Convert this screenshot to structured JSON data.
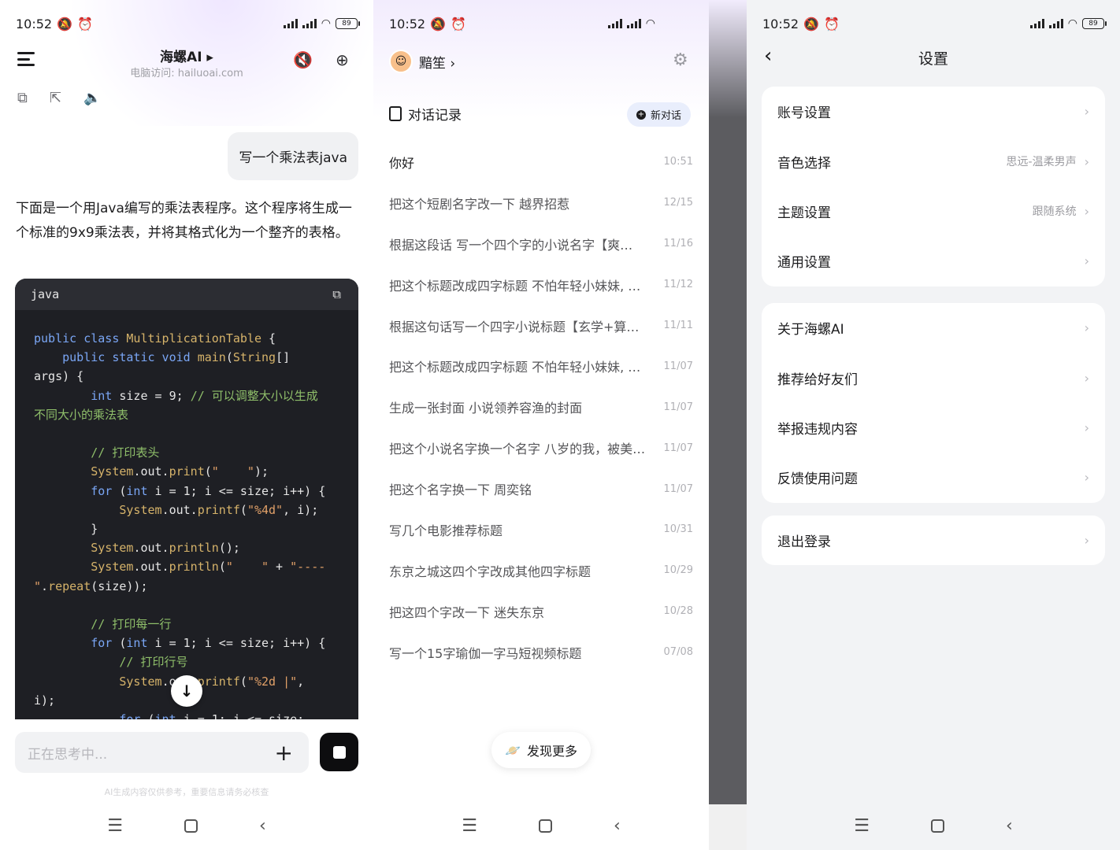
{
  "status": {
    "time": "10:52",
    "battery": "89"
  },
  "chat": {
    "title": "海螺AI ▸",
    "subtitle": "电脑访问: hailuoai.com",
    "user_message": "写一个乘法表java",
    "answer": "下面是一个用Java编写的乘法表程序。这个程序将生成一个标准的9x9乘法表，并将其格式化为一个整齐的表格。",
    "code_lang": "java",
    "input_placeholder": "正在思考中...",
    "disclaimer": "AI生成内容仅供参考，重要信息请务必核查"
  },
  "drawer": {
    "username": "黯笙",
    "section_title": "对话记录",
    "new_chat": "新对话",
    "history": [
      {
        "title": "你好",
        "date": "10:51"
      },
      {
        "title": "把这个短剧名字改一下 越界招惹",
        "date": "12/15"
      },
      {
        "title": "根据这段话 写一个四个字的小说名字【爽…",
        "date": "11/16"
      },
      {
        "title": "把这个标题改成四字标题 不怕年轻小妹妹, …",
        "date": "11/12"
      },
      {
        "title": "根据这句话写一个四字小说标题【玄学+算…",
        "date": "11/11"
      },
      {
        "title": "把这个标题改成四字标题 不怕年轻小妹妹, …",
        "date": "11/07"
      },
      {
        "title": "生成一张封面 小说领养容渔的封面",
        "date": "11/07"
      },
      {
        "title": "把这个小说名字换一个名字 八岁的我，被美…",
        "date": "11/07"
      },
      {
        "title": "把这个名字换一下 周奕铭",
        "date": "11/07"
      },
      {
        "title": "写几个电影推荐标题",
        "date": "10/31"
      },
      {
        "title": "东京之城这四个字改成其他四字标题",
        "date": "10/29"
      },
      {
        "title": "把这四个字改一下 迷失东京",
        "date": "10/28"
      },
      {
        "title": "写一个15字瑜伽一字马短视频标题",
        "date": "07/08"
      }
    ],
    "discover": "发现更多"
  },
  "settings": {
    "title": "设置",
    "group1": [
      {
        "label": "账号设置",
        "value": ""
      },
      {
        "label": "音色选择",
        "value": "思远-温柔男声"
      },
      {
        "label": "主题设置",
        "value": "跟随系统"
      },
      {
        "label": "通用设置",
        "value": ""
      }
    ],
    "group2": [
      {
        "label": "关于海螺AI"
      },
      {
        "label": "推荐给好友们"
      },
      {
        "label": "举报违规内容"
      },
      {
        "label": "反馈使用问题"
      }
    ],
    "logout": "退出登录"
  }
}
